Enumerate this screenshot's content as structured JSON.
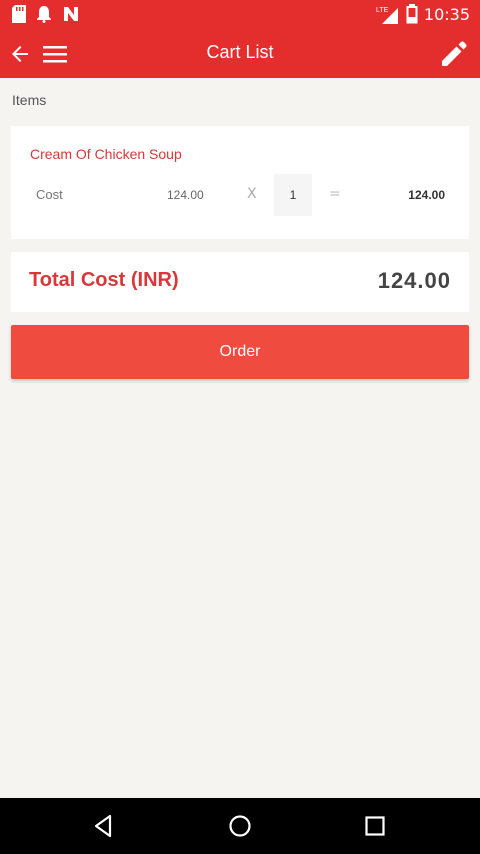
{
  "status_bar": {
    "time": "10:35",
    "network": "LTE"
  },
  "app_bar": {
    "title": "Cart List"
  },
  "section": {
    "label": "Items"
  },
  "cart": {
    "items": [
      {
        "name": "Cream Of Chicken Soup",
        "cost_label": "Cost",
        "unit_price": "124.00",
        "times": "X",
        "quantity": "1",
        "equals": "=",
        "line_total": "124.00"
      }
    ]
  },
  "summary": {
    "total_label": "Total Cost (INR)",
    "total_value": "124.00"
  },
  "actions": {
    "order_label": "Order"
  },
  "colors": {
    "primary": "#e42e2e",
    "accent_button": "#ef4b3f",
    "text_red": "#d8383a",
    "background": "#f6f4f1"
  },
  "icons": [
    "sd-card-icon",
    "notification-bell-icon",
    "n-icon",
    "lte-signal-icon",
    "battery-icon",
    "back-arrow-icon",
    "menu-icon",
    "edit-pencil-icon",
    "nav-back-icon",
    "nav-home-icon",
    "nav-recents-icon"
  ]
}
